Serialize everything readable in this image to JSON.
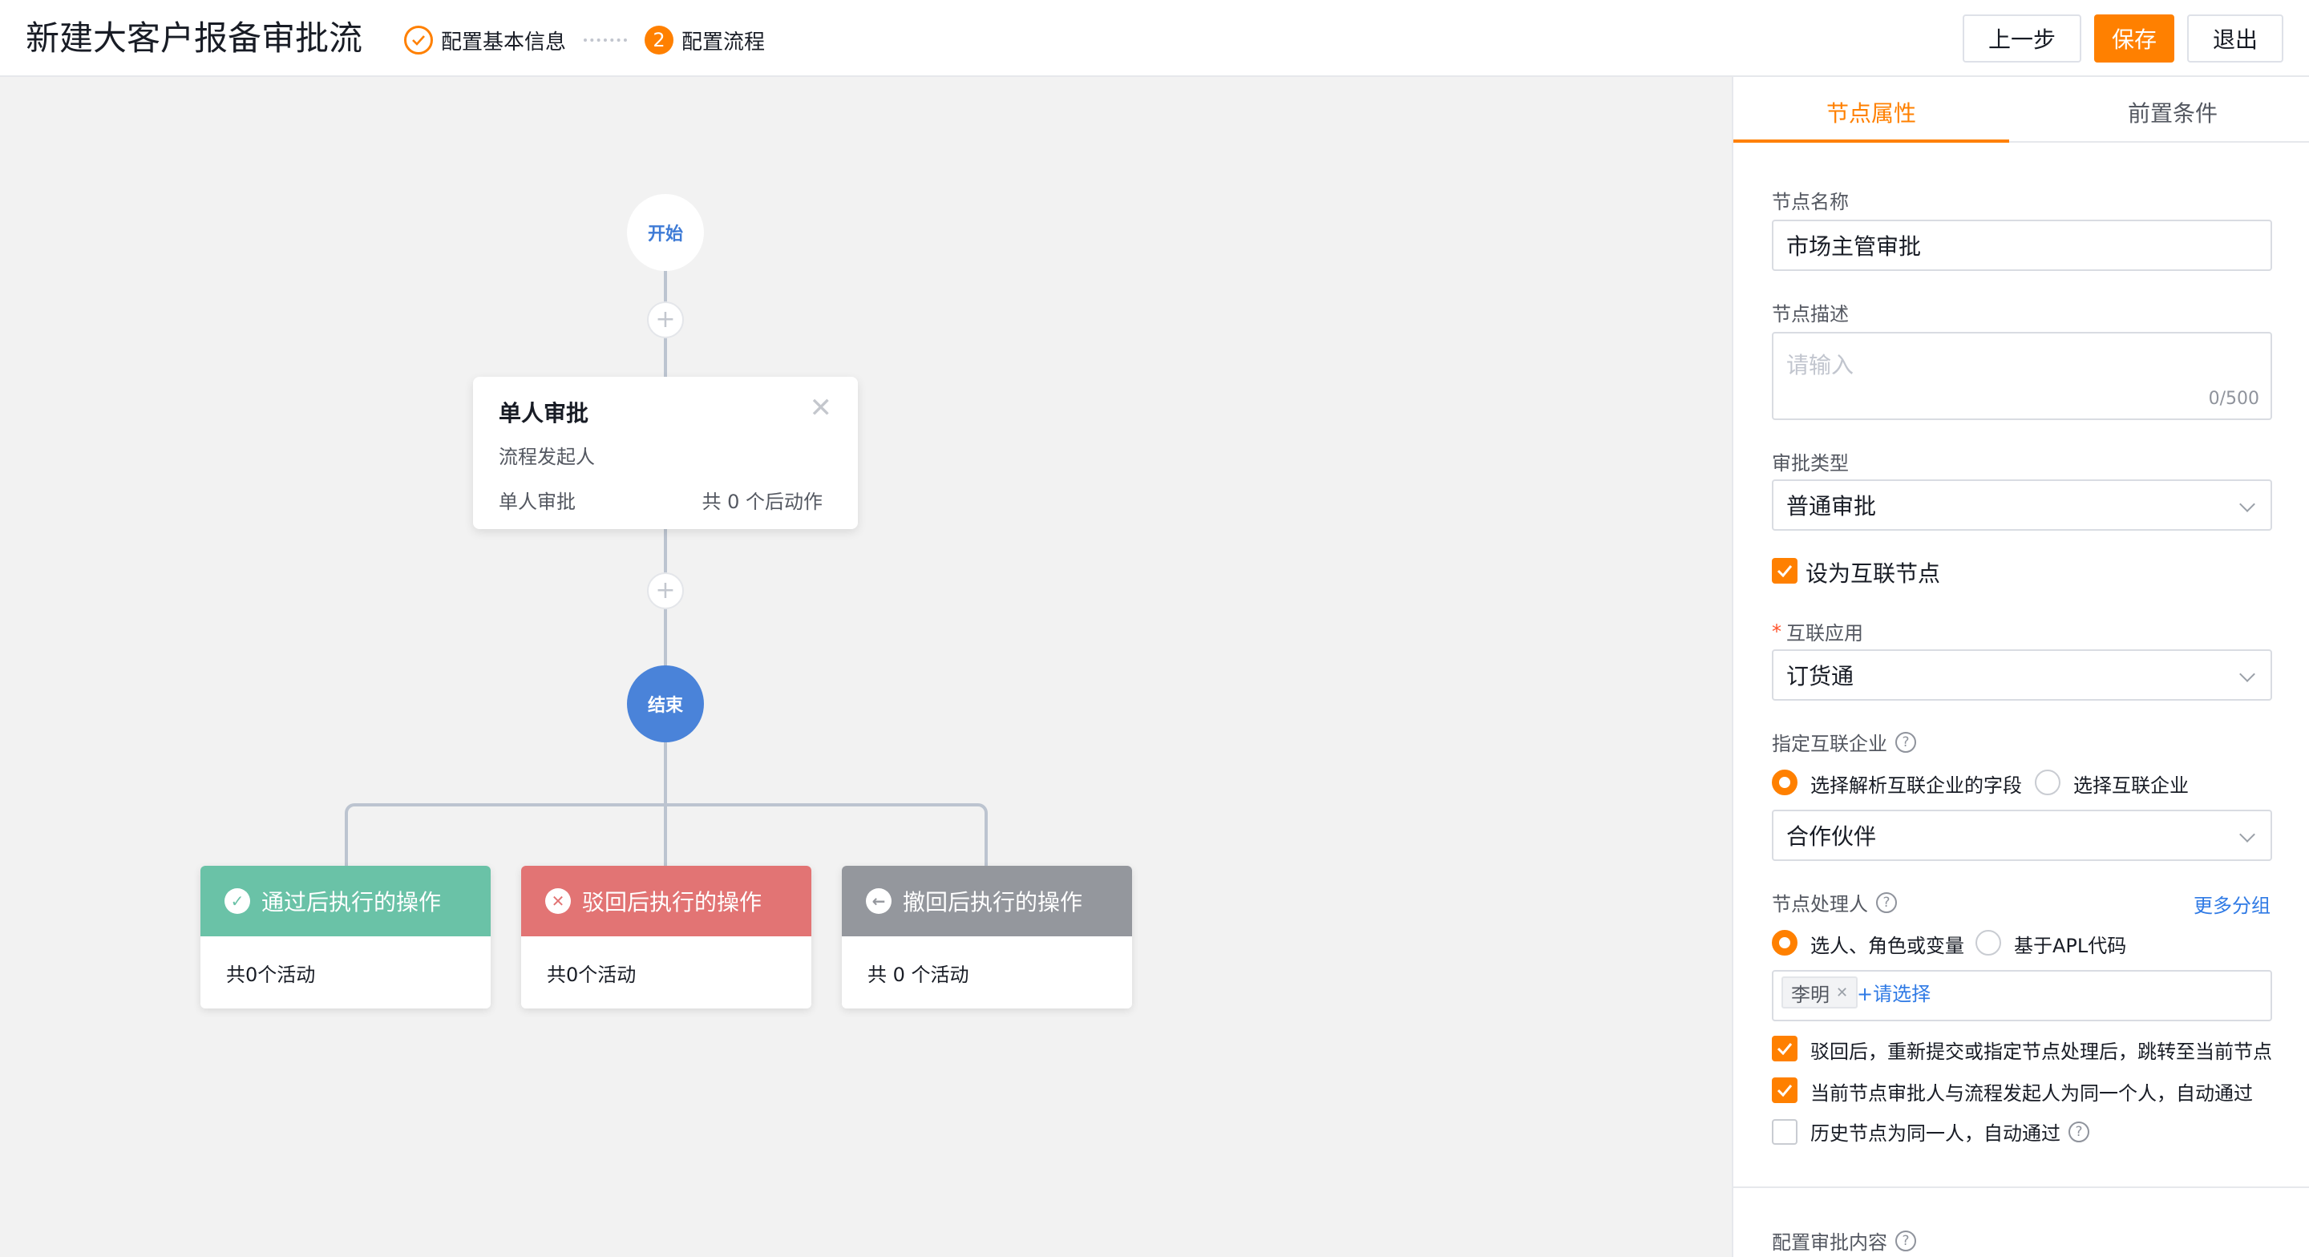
{
  "header": {
    "title": "新建大客户报备审批流",
    "steps": [
      {
        "label": "配置基本信息",
        "state": "done"
      },
      {
        "number": "2",
        "label": "配置流程",
        "state": "active"
      }
    ],
    "buttons": {
      "prev": "上一步",
      "save": "保存",
      "exit": "退出"
    }
  },
  "canvas": {
    "start_label": "开始",
    "end_label": "结束",
    "plus_symbol": "+",
    "approval_node": {
      "title": "单人审批",
      "subtitle": "流程发起人",
      "type": "单人审批",
      "action_count": "共 0 个后动作",
      "close_symbol": "✕"
    },
    "action_cards": [
      {
        "title": "通过后执行的操作",
        "count": "共0个活动",
        "color": "#6ac2a7",
        "icon": "check-circle-icon"
      },
      {
        "title": "驳回后执行的操作",
        "count": "共0个活动",
        "color": "#e27474",
        "icon": "x-circle-icon"
      },
      {
        "title": "撤回后执行的操作",
        "count": "共 0 个活动",
        "color": "#94979d",
        "icon": "arrow-left-circle-icon"
      }
    ]
  },
  "panel": {
    "tabs": [
      {
        "label": "节点属性",
        "active": true
      },
      {
        "label": "前置条件",
        "active": false
      }
    ],
    "node_name": {
      "label": "节点名称",
      "value": "市场主管审批"
    },
    "node_desc": {
      "label": "节点描述",
      "placeholder": "请输入",
      "counter": "0/500"
    },
    "approval_type": {
      "label": "审批类型",
      "value": "普通审批"
    },
    "interconnect_node": {
      "label": "设为互联节点",
      "checked": true
    },
    "interconnect_app": {
      "required_mark": "*",
      "label": "互联应用",
      "value": "订货通"
    },
    "interconnect_enterprise": {
      "label": "指定互联企业",
      "options": [
        "选择解析互联企业的字段",
        "选择互联企业"
      ],
      "selected": "选择解析互联企业的字段",
      "value": "合作伙伴"
    },
    "handler": {
      "label": "节点处理人",
      "more_link": "更多分组",
      "options": [
        "选人、角色或变量",
        "基于APL代码"
      ],
      "selected": "选人、角色或变量",
      "tags": [
        "李明"
      ],
      "choose_link": "+请选择"
    },
    "checkboxes": [
      {
        "label": "驳回后，重新提交或指定节点处理后，跳转至当前节点",
        "checked": true
      },
      {
        "label": "当前节点审批人与流程发起人为同一个人，自动通过",
        "checked": true
      },
      {
        "label": "历史节点为同一人，自动通过",
        "checked": false,
        "help": true
      }
    ],
    "approval_content_label": "配置审批内容",
    "help_symbol": "?",
    "accent": "#ff8000",
    "link_color": "#2f7ae5"
  }
}
